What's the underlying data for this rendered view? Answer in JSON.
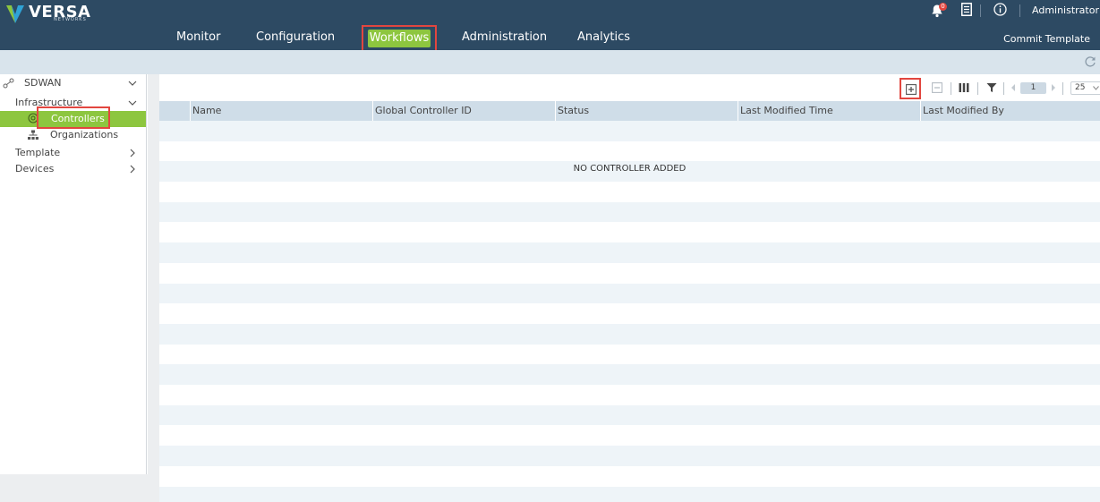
{
  "brand": {
    "name": "VERSA",
    "sub": "NETWORKS",
    "colors": {
      "header": "#2d4a63",
      "accent": "#8dc63f",
      "highlight": "#e2463f",
      "subbar": "#d9e4ec"
    }
  },
  "nav": {
    "items": [
      {
        "label": "Monitor"
      },
      {
        "label": "Configuration"
      },
      {
        "label": "Workflows",
        "active": true
      },
      {
        "label": "Administration"
      },
      {
        "label": "Analytics"
      }
    ]
  },
  "header": {
    "notifications_count": "0",
    "user_label": "Administrator",
    "commit_label": "Commit Template"
  },
  "sidebar": {
    "items": [
      {
        "label": "SDWAN",
        "icon": "sdwan-icon"
      },
      {
        "label": "Infrastructure"
      },
      {
        "label": "Controllers",
        "icon": "controller-icon",
        "selected": true
      },
      {
        "label": "Organizations",
        "icon": "organization-icon"
      },
      {
        "label": "Template"
      },
      {
        "label": "Devices"
      }
    ]
  },
  "toolbar": {
    "page": "1",
    "page_size": "25"
  },
  "table": {
    "columns": [
      "Name",
      "Global Controller ID",
      "Status",
      "Last Modified Time",
      "Last Modified By"
    ],
    "empty_message": "NO CONTROLLER ADDED"
  }
}
